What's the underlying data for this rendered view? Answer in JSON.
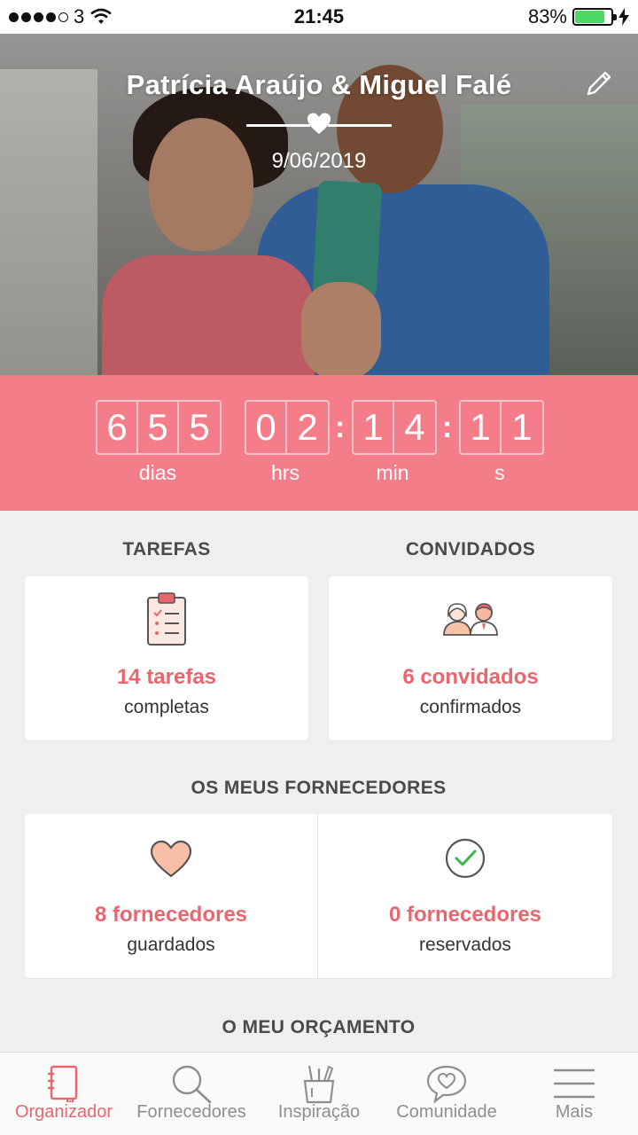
{
  "status_bar": {
    "carrier": "3",
    "time": "21:45",
    "battery_percent": "83%",
    "battery_level": 0.83,
    "signal_bars": 4
  },
  "header": {
    "couple_name": "Patrícia Araújo & Miguel Falé",
    "wedding_date": "9/06/2019"
  },
  "countdown": {
    "days": [
      "6",
      "5",
      "5"
    ],
    "hours": [
      "0",
      "2"
    ],
    "minutes": [
      "1",
      "4"
    ],
    "seconds": [
      "1",
      "1"
    ],
    "units": {
      "days": "dias",
      "hours": "hrs",
      "minutes": "min",
      "seconds": "s"
    }
  },
  "tasks": {
    "title": "TAREFAS",
    "value": "14 tarefas",
    "sub": "completas"
  },
  "guests": {
    "title": "CONVIDADOS",
    "value": "6 convidados",
    "sub": "confirmados"
  },
  "vendors": {
    "title": "OS MEUS FORNECEDORES",
    "saved_value": "8 fornecedores",
    "saved_sub": "guardados",
    "booked_value": "0 fornecedores",
    "booked_sub": "reservados"
  },
  "budget": {
    "title": "O MEU ORÇAMENTO"
  },
  "tabs": [
    {
      "label": "Organizador",
      "icon": "notebook-icon",
      "active": true
    },
    {
      "label": "Fornecedores",
      "icon": "search-icon",
      "active": false
    },
    {
      "label": "Inspiração",
      "icon": "pencil-cup-icon",
      "active": false
    },
    {
      "label": "Comunidade",
      "icon": "chat-heart-icon",
      "active": false
    },
    {
      "label": "Mais",
      "icon": "menu-icon",
      "active": false
    }
  ],
  "colors": {
    "accent": "#e9666f",
    "countdown_bg": "#f37d88",
    "page_bg": "#f0efef"
  }
}
